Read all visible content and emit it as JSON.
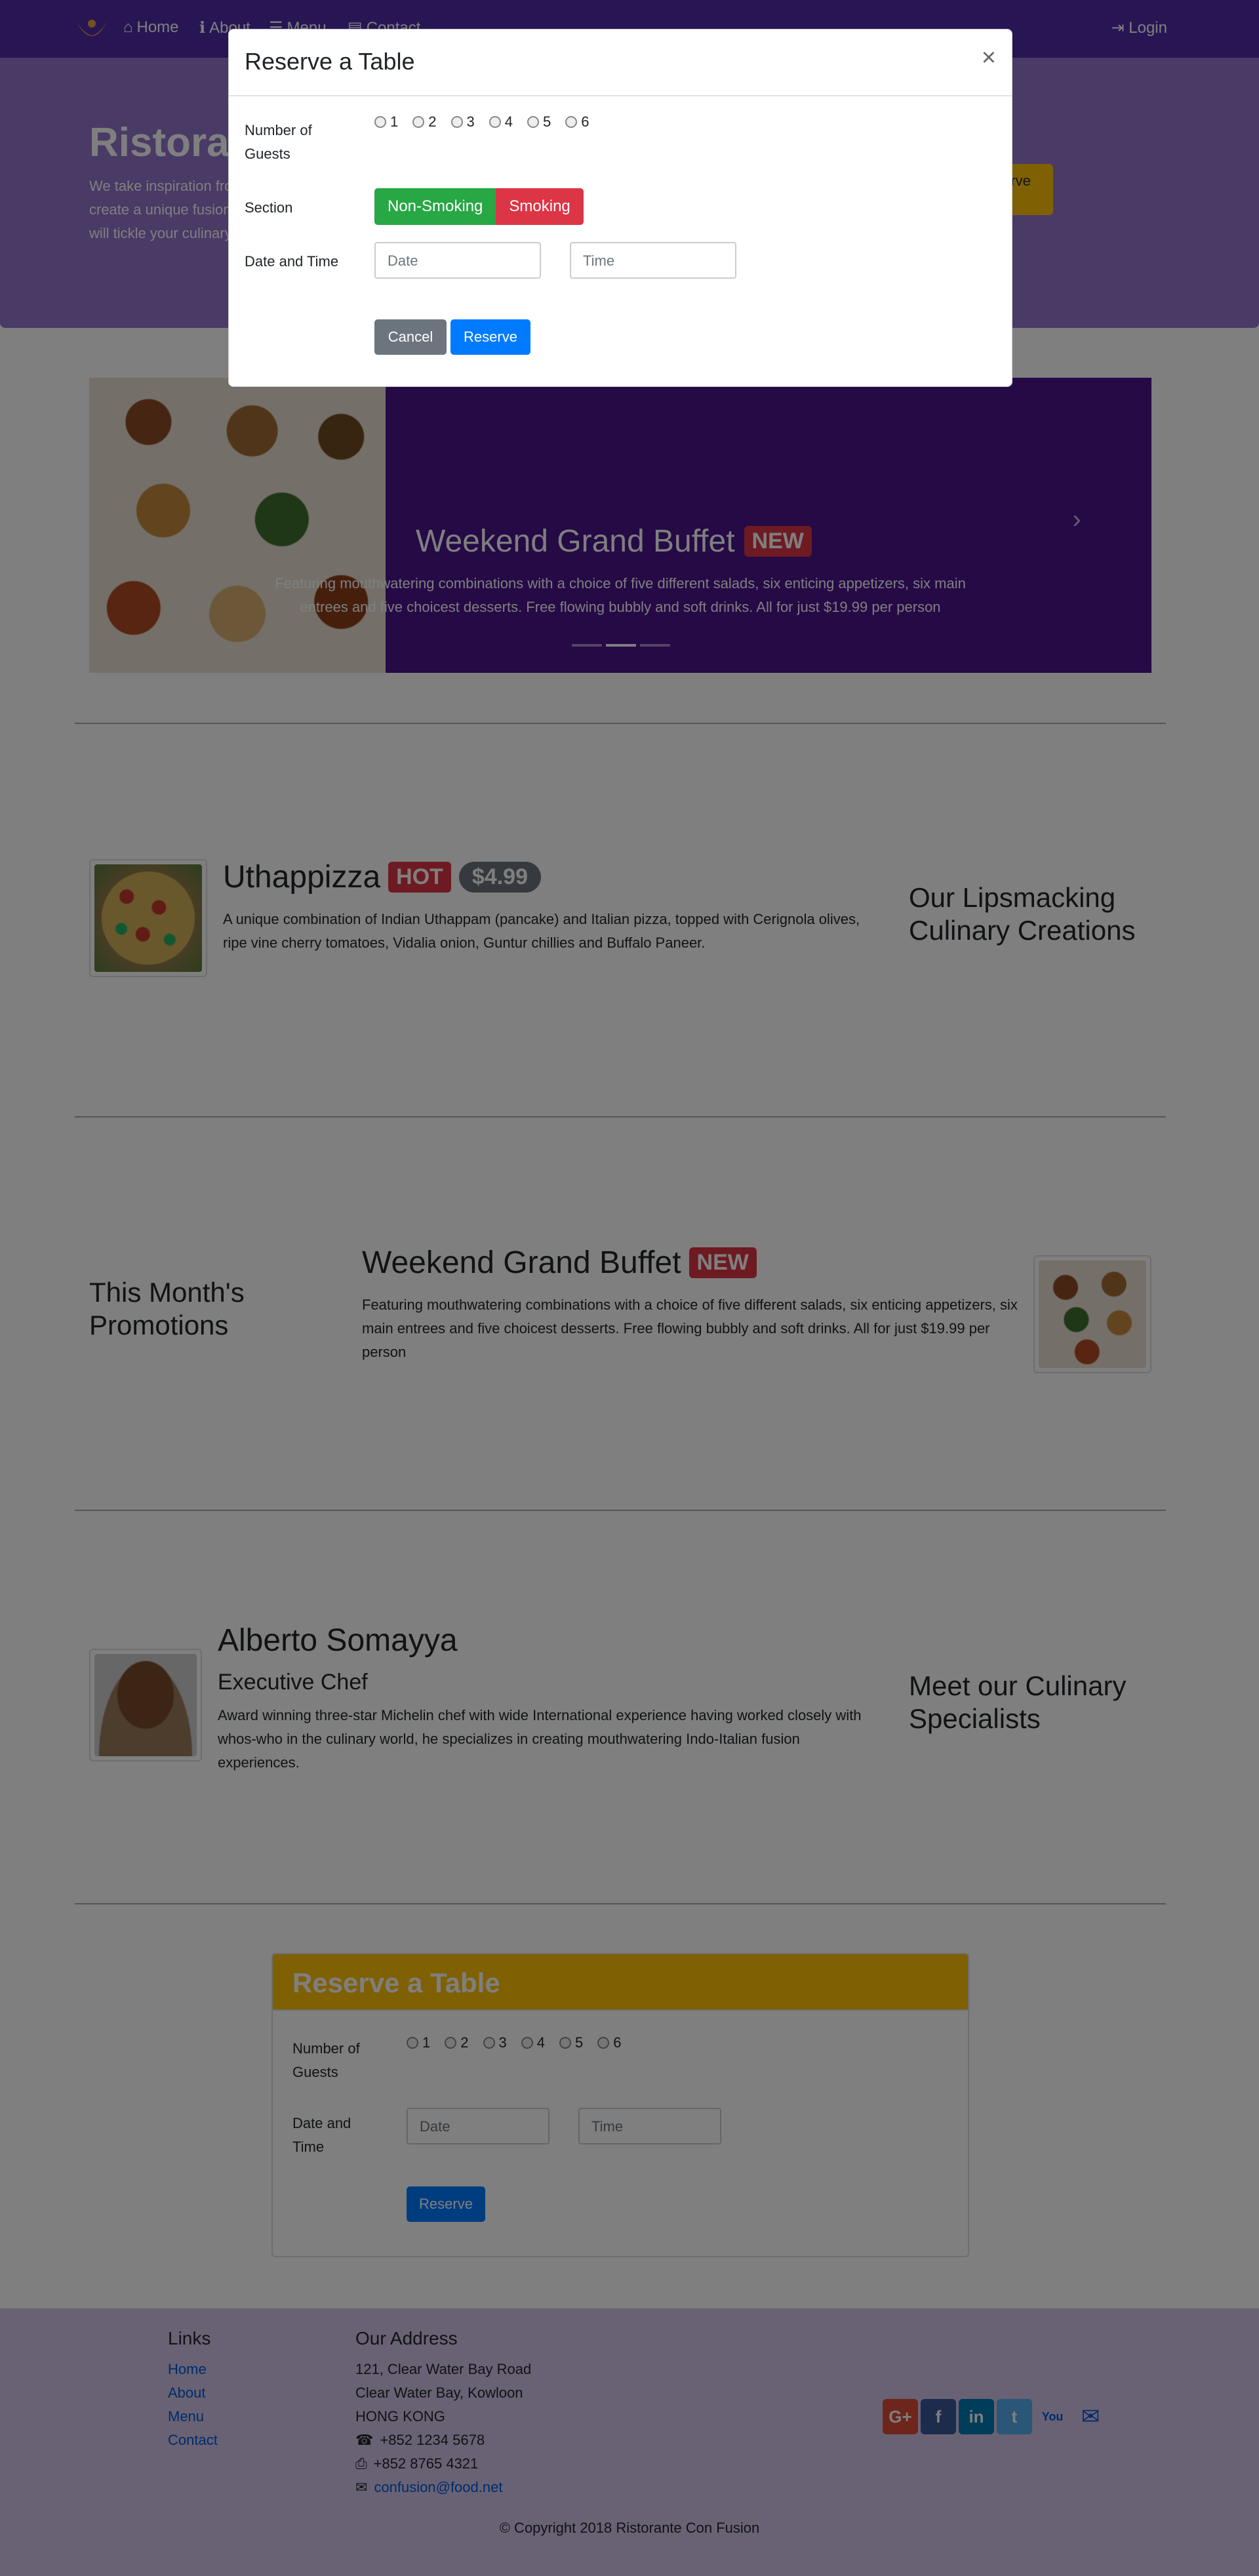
{
  "nav": {
    "items": [
      {
        "label": "Home",
        "icon": "home-icon"
      },
      {
        "label": "About",
        "icon": "info-icon"
      },
      {
        "label": "Menu",
        "icon": "list-icon"
      },
      {
        "label": "Contact",
        "icon": "address-card-icon"
      }
    ],
    "login": "Login"
  },
  "jumbotron": {
    "title": "Ristorante con Fusion",
    "text": "We take inspiration from the World's best cuisines, and create a unique fusion experience. Our lipsmacking creations will tickle your culinary senses!",
    "button": "Reserve Table"
  },
  "carousel": {
    "title": "Weekend Grand Buffet",
    "badge": "NEW",
    "text": "Featuring mouthwatering combinations with a choice of five different salads, six enticing appetizers, six main entrees and five choicest desserts. Free flowing bubbly and soft drinks. All for just $19.99 per person",
    "active_index": 1,
    "slide_count": 3
  },
  "dish": {
    "title": "Uthappizza",
    "badge_hot": "HOT",
    "price": "$4.99",
    "text": "A unique combination of Indian Uthappam (pancake) and Italian pizza, topped with Cerignola olives, ripe vine cherry tomatoes, Vidalia onion, Guntur chillies and Buffalo Paneer.",
    "side_heading": "Our Lipsmacking Culinary Creations"
  },
  "promotion": {
    "side_heading": "This Month's Promotions",
    "title": "Weekend Grand Buffet",
    "badge": "NEW",
    "text": "Featuring mouthwatering combinations with a choice of five different salads, six enticing appetizers, six main entrees and five choicest desserts. Free flowing bubbly and soft drinks. All for just $19.99 per person"
  },
  "leader": {
    "name": "Alberto Somayya",
    "designation": "Executive Chef",
    "text": "Award winning three-star Michelin chef with wide International experience having worked closely with whos-who in the culinary world, he specializes in creating mouthwatering Indo-Italian fusion experiences.",
    "side_heading": "Meet our Culinary Specialists"
  },
  "reserve_card": {
    "header": "Reserve a Table",
    "guests_label": "Number of Guests",
    "guest_options": [
      "1",
      "2",
      "3",
      "4",
      "5",
      "6"
    ],
    "datetime_label": "Date and Time",
    "date_placeholder": "Date",
    "time_placeholder": "Time",
    "submit": "Reserve"
  },
  "modal": {
    "title": "Reserve a Table",
    "close": "×",
    "guests_label": "Number of Guests",
    "guest_options": [
      "1",
      "2",
      "3",
      "4",
      "5",
      "6"
    ],
    "section_label": "Section",
    "section_options": [
      "Non-Smoking",
      "Smoking"
    ],
    "datetime_label": "Date and Time",
    "date_placeholder": "Date",
    "time_placeholder": "Time",
    "cancel": "Cancel",
    "submit": "Reserve"
  },
  "footer": {
    "links_heading": "Links",
    "links": [
      "Home",
      "About",
      "Menu",
      "Contact"
    ],
    "address_heading": "Our Address",
    "address_lines": [
      "121, Clear Water Bay Road",
      "Clear Water Bay, Kowloon",
      "HONG KONG"
    ],
    "phone": "+852 1234 5678",
    "fax": "+852 8765 4321",
    "email": "confusion@food.net",
    "social": [
      {
        "name": "google-plus-icon",
        "glyph": "G+",
        "color": "#dd4b39"
      },
      {
        "name": "facebook-icon",
        "glyph": "f",
        "color": "#3b5998"
      },
      {
        "name": "linkedin-icon",
        "glyph": "in",
        "color": "#007bb5"
      },
      {
        "name": "twitter-icon",
        "glyph": "t",
        "color": "#55acee"
      },
      {
        "name": "youtube-icon",
        "glyph": "You",
        "color": "#bb0000"
      },
      {
        "name": "mail-icon",
        "glyph": "✉",
        "color": "#0056d6"
      }
    ],
    "copyright": "© Copyright 2018 Ristorante Con Fusion"
  },
  "colors": {
    "navbar": "#512da8",
    "jumbotron": "#9575cd",
    "footer": "#d1c4e9",
    "warning": "#ffc107",
    "primary": "#007bff",
    "success": "#28a745",
    "danger": "#dc3545"
  }
}
